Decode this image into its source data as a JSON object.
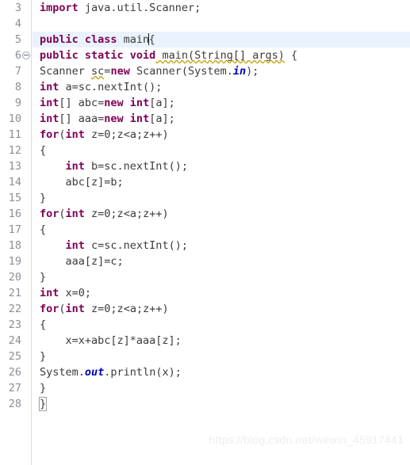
{
  "editor": {
    "language": "java",
    "first_line_number": 3,
    "current_line_number": 5,
    "fold_marker_line": 6,
    "colors": {
      "background": "#ffffff",
      "keyword": "#7f0055",
      "identifier": "#3b3b3b",
      "static_field": "#0000c0",
      "line_number": "#8b8f96",
      "current_line_highlight": "#e9f2fd",
      "gutter_border": "#d7dce3",
      "warning_squiggle": "#c8a415",
      "watermark": "#eceef0"
    },
    "lines": [
      {
        "n": "3",
        "text": "import java.util.Scanner;"
      },
      {
        "n": "4",
        "text": ""
      },
      {
        "n": "5",
        "text": "public class main{"
      },
      {
        "n": "6",
        "text": "public static void main(String[] args) {"
      },
      {
        "n": "7",
        "text": "Scanner sc=new Scanner(System.in);"
      },
      {
        "n": "8",
        "text": "int a=sc.nextInt();"
      },
      {
        "n": "9",
        "text": "int[] abc=new int[a];"
      },
      {
        "n": "10",
        "text": "int[] aaa=new int[a];"
      },
      {
        "n": "11",
        "text": "for(int z=0;z<a;z++)"
      },
      {
        "n": "12",
        "text": "{"
      },
      {
        "n": "13",
        "text": "    int b=sc.nextInt();"
      },
      {
        "n": "14",
        "text": "    abc[z]=b;"
      },
      {
        "n": "15",
        "text": "}"
      },
      {
        "n": "16",
        "text": "for(int z=0;z<a;z++)"
      },
      {
        "n": "17",
        "text": "{"
      },
      {
        "n": "18",
        "text": "    int c=sc.nextInt();"
      },
      {
        "n": "19",
        "text": "    aaa[z]=c;"
      },
      {
        "n": "20",
        "text": "}"
      },
      {
        "n": "21",
        "text": "int x=0;"
      },
      {
        "n": "22",
        "text": "for(int z=0;z<a;z++)"
      },
      {
        "n": "23",
        "text": "{"
      },
      {
        "n": "24",
        "text": "    x=x+abc[z]*aaa[z];"
      },
      {
        "n": "25",
        "text": "}"
      },
      {
        "n": "26",
        "text": "System.out.println(x);"
      },
      {
        "n": "27",
        "text": "}"
      },
      {
        "n": "28",
        "text": "}"
      }
    ]
  },
  "watermark": {
    "text": "https://blog.csdn.net/weixin_45917441"
  }
}
